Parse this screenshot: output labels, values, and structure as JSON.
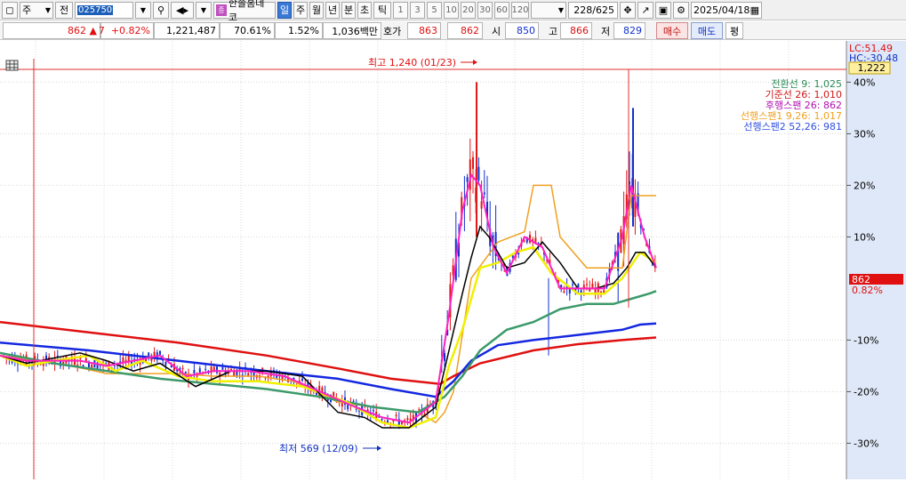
{
  "toolbar": {
    "market_label": "주",
    "prefix_label": "전",
    "code_value": "025750",
    "stock_name": "한솔홈데코",
    "periods": [
      "일",
      "주",
      "월",
      "년",
      "분",
      "초",
      "틱"
    ],
    "active_period": "일",
    "intervals": [
      "1",
      "3",
      "5",
      "10",
      "20",
      "30",
      "60",
      "120"
    ],
    "count": "228",
    "count_total": "/625",
    "date": "2025/04/18"
  },
  "quote": {
    "price": "862",
    "arrow": "▲",
    "change": "7",
    "change_pct": "+0.82%",
    "volume": "1,221,487",
    "vol_ratio": "70.61%",
    "turnover_pct": "1.52%",
    "amount": "1,036백만",
    "hoga_label": "호가",
    "hoga_value": "863",
    "hoga_value2": "862",
    "open_label": "시",
    "open_value": "850",
    "high_label": "고",
    "high_value": "866",
    "low_label": "저",
    "low_value": "829",
    "buy_label": "매수",
    "sell_label": "매도",
    "avg_label": "평"
  },
  "chart_data": {
    "type": "candlestick",
    "y_axis": {
      "ticks": [
        "40%",
        "30%",
        "20%",
        "10%",
        "-10%",
        "-20%",
        "-30%"
      ],
      "tick_values": [
        40,
        30,
        20,
        10,
        -10,
        -20,
        -30
      ],
      "ylim": [
        -37,
        48
      ],
      "current_price_label": "862",
      "current_pct_label": "0.82%",
      "lc_label": "LC:51.49",
      "hc_label": "HC:-30.48",
      "hc_box": "1,222"
    },
    "annotations": {
      "high": "최고 1,240 (01/23)",
      "low": "최저 569 (12/09)"
    },
    "legend": [
      {
        "text": "전환선 9: 1,025",
        "color": "#2a8a55"
      },
      {
        "text": "기준선 26: 1,010",
        "color": "#d01818"
      },
      {
        "text": "후행스팬 26: 862",
        "color": "#b010b0"
      },
      {
        "text": "선행스팬1 9,26: 1,017",
        "color": "#f0a020"
      },
      {
        "text": "선행스팬2 52,26: 981",
        "color": "#3050e0"
      }
    ],
    "colors": {
      "up": "#e01818",
      "down": "#1030d0",
      "ma_short": "#ff20c0",
      "ma_mid": "#000000",
      "ma_yellow": "#f0f000",
      "ma_green": "#3c9a6a",
      "ma_blue": "#1428e0",
      "ma_red": "#e01010",
      "span": "#f0a020"
    },
    "series": {
      "red_line": [
        [
          0,
          -6.5
        ],
        [
          100,
          -8.5
        ],
        [
          200,
          -10.5
        ],
        [
          300,
          -13
        ],
        [
          380,
          -15.5
        ],
        [
          440,
          -17.5
        ],
        [
          495,
          -18.5
        ],
        [
          510,
          -17
        ],
        [
          540,
          -14.5
        ],
        [
          600,
          -12
        ],
        [
          650,
          -10.8
        ],
        [
          700,
          -10
        ],
        [
          738,
          -9.5
        ]
      ],
      "blue_line": [
        [
          0,
          -10.5
        ],
        [
          100,
          -12
        ],
        [
          200,
          -14
        ],
        [
          300,
          -16
        ],
        [
          380,
          -17.5
        ],
        [
          440,
          -19.5
        ],
        [
          490,
          -21
        ],
        [
          510,
          -18
        ],
        [
          530,
          -14
        ],
        [
          560,
          -11
        ],
        [
          600,
          -10
        ],
        [
          650,
          -9
        ],
        [
          700,
          -8
        ],
        [
          720,
          -7
        ],
        [
          738,
          -6.8
        ]
      ],
      "green_line": [
        [
          0,
          -12.5
        ],
        [
          60,
          -14.5
        ],
        [
          120,
          -16
        ],
        [
          180,
          -17.5
        ],
        [
          240,
          -18.5
        ],
        [
          300,
          -19.5
        ],
        [
          360,
          -21
        ],
        [
          420,
          -23
        ],
        [
          470,
          -24
        ],
        [
          500,
          -21
        ],
        [
          520,
          -17
        ],
        [
          540,
          -12
        ],
        [
          570,
          -8
        ],
        [
          600,
          -6.5
        ],
        [
          630,
          -4
        ],
        [
          660,
          -3
        ],
        [
          690,
          -3
        ],
        [
          710,
          -2
        ],
        [
          730,
          -1
        ],
        [
          738,
          -0.5
        ]
      ],
      "black_line": [
        [
          0,
          -13
        ],
        [
          30,
          -14.5
        ],
        [
          60,
          -13.5
        ],
        [
          90,
          -12.5
        ],
        [
          120,
          -14
        ],
        [
          150,
          -16
        ],
        [
          180,
          -14.5
        ],
        [
          220,
          -19
        ],
        [
          260,
          -16
        ],
        [
          300,
          -16
        ],
        [
          340,
          -17
        ],
        [
          380,
          -24
        ],
        [
          410,
          -25
        ],
        [
          430,
          -27
        ],
        [
          460,
          -27
        ],
        [
          490,
          -23
        ],
        [
          505,
          -12
        ],
        [
          520,
          -1
        ],
        [
          530,
          6
        ],
        [
          540,
          12
        ],
        [
          550,
          10
        ],
        [
          570,
          4
        ],
        [
          590,
          5
        ],
        [
          610,
          9
        ],
        [
          630,
          5
        ],
        [
          650,
          0
        ],
        [
          670,
          0
        ],
        [
          690,
          1
        ],
        [
          705,
          4
        ],
        [
          715,
          7
        ],
        [
          725,
          7
        ],
        [
          738,
          4
        ]
      ],
      "yellow_line": [
        [
          0,
          -13
        ],
        [
          30,
          -15
        ],
        [
          60,
          -14
        ],
        [
          100,
          -13
        ],
        [
          130,
          -16
        ],
        [
          160,
          -14
        ],
        [
          200,
          -17
        ],
        [
          240,
          -18
        ],
        [
          290,
          -18
        ],
        [
          340,
          -19
        ],
        [
          390,
          -22
        ],
        [
          430,
          -26
        ],
        [
          460,
          -27
        ],
        [
          490,
          -25
        ],
        [
          505,
          -15
        ],
        [
          520,
          -8
        ],
        [
          540,
          4
        ],
        [
          560,
          5
        ],
        [
          580,
          7
        ],
        [
          600,
          8
        ],
        [
          620,
          3
        ],
        [
          650,
          -1
        ],
        [
          680,
          -1
        ],
        [
          700,
          2
        ],
        [
          720,
          7
        ],
        [
          738,
          5
        ]
      ],
      "magenta_line": [
        [
          0,
          -13
        ],
        [
          30,
          -14
        ],
        [
          60,
          -14
        ],
        [
          90,
          -14
        ],
        [
          120,
          -15
        ],
        [
          150,
          -14
        ],
        [
          180,
          -13
        ],
        [
          210,
          -17
        ],
        [
          240,
          -16
        ],
        [
          280,
          -16
        ],
        [
          320,
          -17
        ],
        [
          360,
          -20
        ],
        [
          400,
          -23
        ],
        [
          430,
          -25
        ],
        [
          460,
          -26
        ],
        [
          490,
          -22
        ],
        [
          505,
          -5
        ],
        [
          520,
          15
        ],
        [
          530,
          22
        ],
        [
          540,
          20
        ],
        [
          555,
          8
        ],
        [
          570,
          3
        ],
        [
          590,
          10
        ],
        [
          610,
          8
        ],
        [
          630,
          0
        ],
        [
          650,
          0
        ],
        [
          680,
          0
        ],
        [
          700,
          10
        ],
        [
          710,
          20
        ],
        [
          725,
          10
        ],
        [
          738,
          4
        ]
      ],
      "span_line": [
        [
          0,
          -13
        ],
        [
          40,
          -14
        ],
        [
          80,
          -15
        ],
        [
          120,
          -16.5
        ],
        [
          130,
          -16.5
        ],
        [
          200,
          -16.5
        ],
        [
          240,
          -17
        ],
        [
          290,
          -17
        ],
        [
          330,
          -18
        ],
        [
          380,
          -22
        ],
        [
          420,
          -23
        ],
        [
          470,
          -24
        ],
        [
          490,
          -26
        ],
        [
          500,
          -24
        ],
        [
          510,
          -20
        ],
        [
          530,
          2
        ],
        [
          560,
          9
        ],
        [
          590,
          11
        ],
        [
          600,
          20
        ],
        [
          610,
          20
        ],
        [
          620,
          20
        ],
        [
          630,
          10
        ],
        [
          660,
          4
        ],
        [
          700,
          4
        ],
        [
          710,
          18
        ],
        [
          738,
          18
        ]
      ]
    }
  }
}
